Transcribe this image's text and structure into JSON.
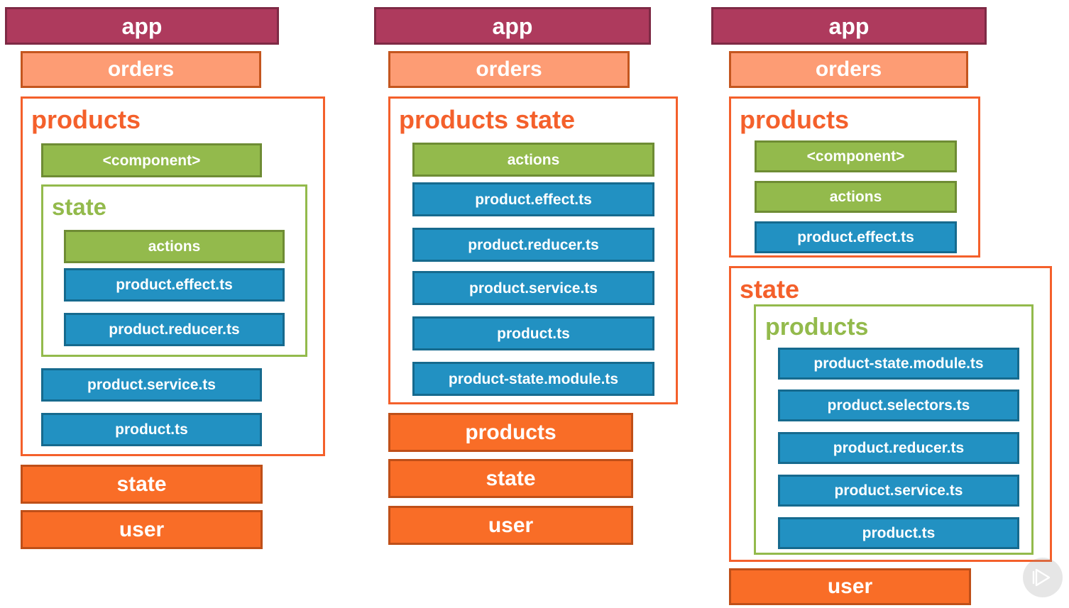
{
  "diagram": {
    "title": "Angular NgRx feature-module folder structure — three refactoring stages",
    "colors": {
      "app_fill": "#AE3A5D",
      "app_border": "#7E2A45",
      "orders_fill": "#FD9C74",
      "orders_border": "#C4561F",
      "orange_fill": "#F96D27",
      "orange_border": "#BF4F18",
      "green_fill": "#93BA4C",
      "green_border": "#6E8C34",
      "blue_fill": "#2291C2",
      "blue_border": "#166A8E",
      "group_orange_stroke": "#F4602B",
      "group_green_stroke": "#93BA4C",
      "background": "#FFFFFF"
    }
  },
  "columns": [
    {
      "id": "column-1",
      "app_label": "app",
      "orders_label": "orders",
      "products_group_title": "products",
      "products_component_label": "<component>",
      "state_group_title": "state",
      "state_items": [
        {
          "label": "actions",
          "kind": "green"
        },
        {
          "label": "product.effect.ts",
          "kind": "blue"
        },
        {
          "label": "product.reducer.ts",
          "kind": "blue"
        }
      ],
      "products_tail_items": [
        {
          "label": "product.service.ts",
          "kind": "blue"
        },
        {
          "label": "product.ts",
          "kind": "blue"
        }
      ],
      "footer_items": [
        {
          "label": "state"
        },
        {
          "label": "user"
        }
      ]
    },
    {
      "id": "column-2",
      "app_label": "app",
      "orders_label": "orders",
      "products_group_title": "products state",
      "group_items": [
        {
          "label": "actions",
          "kind": "green"
        },
        {
          "label": "product.effect.ts",
          "kind": "blue"
        },
        {
          "label": "product.reducer.ts",
          "kind": "blue"
        },
        {
          "label": "product.service.ts",
          "kind": "blue"
        },
        {
          "label": "product.ts",
          "kind": "blue"
        },
        {
          "label": "product-state.module.ts",
          "kind": "blue"
        }
      ],
      "footer_items": [
        {
          "label": "products"
        },
        {
          "label": "state"
        },
        {
          "label": "user"
        }
      ]
    },
    {
      "id": "column-3",
      "app_label": "app",
      "orders_label": "orders",
      "products_group_title": "products",
      "products_items": [
        {
          "label": "<component>",
          "kind": "green"
        },
        {
          "label": "actions",
          "kind": "green"
        },
        {
          "label": "product.effect.ts",
          "kind": "blue"
        }
      ],
      "state_group_title": "state",
      "state_products_group_title": "products",
      "state_products_items": [
        {
          "label": "product-state.module.ts",
          "kind": "blue"
        },
        {
          "label": "product.selectors.ts",
          "kind": "blue"
        },
        {
          "label": "product.reducer.ts",
          "kind": "blue"
        },
        {
          "label": "product.service.ts",
          "kind": "blue"
        },
        {
          "label": "product.ts",
          "kind": "blue"
        }
      ],
      "footer_items": [
        {
          "label": "user"
        }
      ]
    }
  ],
  "watermark": {
    "icon": "play-logo-watermark"
  }
}
